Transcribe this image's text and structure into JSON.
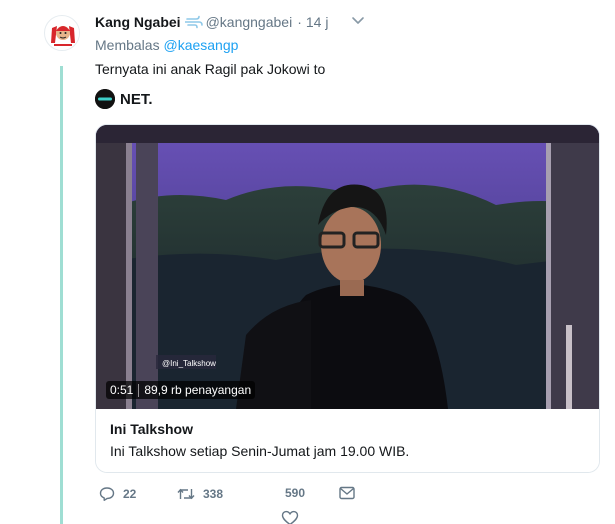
{
  "tweet": {
    "display_name": "Kang Ngabei",
    "name_emoji": "dash-emoji",
    "username": "@kangngabei",
    "separator": "·",
    "time": "14 j",
    "reply_prefix": "Membalas",
    "reply_to": "@kaesangp",
    "text": "Ternyata ini anak Ragil pak Jokowi to",
    "avatar_icon": "avatar-logo-icon"
  },
  "media": {
    "brand_label": "NET.",
    "brand_icon": "net-logo-icon",
    "duration": "0:51",
    "views": "89,9 rb penayangan",
    "watermark": "@Ini_Talkshow"
  },
  "card": {
    "title": "Ini Talkshow",
    "description": "Ini Talkshow setiap Senin-Jumat jam 19.00 WIB."
  },
  "actions": {
    "reply_count": "22",
    "retweet_count": "338",
    "like_count": "590",
    "reply_icon": "reply-icon",
    "retweet_icon": "retweet-icon",
    "like_icon": "heart-icon",
    "dm_icon": "envelope-icon"
  },
  "colors": {
    "thread_line": "#9fded3",
    "link": "#1da1f2",
    "muted": "#657786"
  }
}
